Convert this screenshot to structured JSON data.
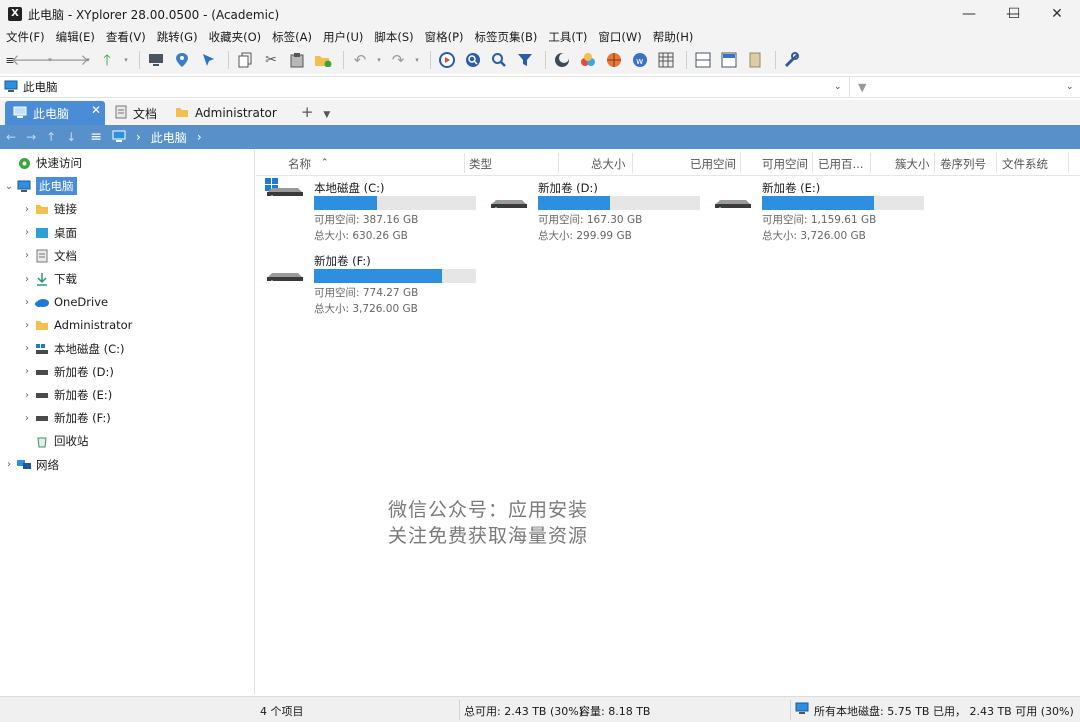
{
  "window": {
    "title": "此电脑 - XYplorer 28.00.0500 - (Academic)",
    "app_icon": "xyplorer-logo",
    "controls": {
      "minimize": "—",
      "maximize": "☐",
      "close": "✕"
    }
  },
  "menu": [
    "文件(F)",
    "编辑(E)",
    "查看(V)",
    "跳转(G)",
    "收藏夹(O)",
    "标签(A)",
    "用户(U)",
    "脚本(S)",
    "窗格(P)",
    "标签页集(B)",
    "工具(T)",
    "窗口(W)",
    "帮助(H)"
  ],
  "toolbar": {
    "icons": [
      "menu-icon",
      "back-icon",
      "forward-icon",
      "up-icon",
      "computer-icon",
      "location-pin-icon",
      "pointer-icon",
      "copy-icon",
      "cut-icon",
      "paste-icon",
      "new-folder-icon",
      "undo-icon",
      "redo-icon",
      "media-play-icon",
      "search-icon",
      "find-icon",
      "filter-icon",
      "moon-icon",
      "colors-icon",
      "basketball-icon",
      "badge-icon",
      "grid-icon",
      "split-h-icon",
      "split-v-icon",
      "book-icon",
      "tools-icon"
    ]
  },
  "address": {
    "value": "此电脑"
  },
  "tabs": [
    {
      "label": "此电脑",
      "active": true
    },
    {
      "label": "文档",
      "active": false
    },
    {
      "label": "Administrator",
      "active": false
    }
  ],
  "breadcrumb": {
    "label": "此电脑"
  },
  "tree": [
    {
      "label": "快速访问",
      "icon": "quick-access-icon",
      "indent": 1,
      "arrow": ""
    },
    {
      "label": "此电脑",
      "icon": "computer-icon",
      "indent": 1,
      "arrow": "⌄",
      "selected": true
    },
    {
      "label": "链接",
      "icon": "folder-icon",
      "indent": 2,
      "arrow": "›"
    },
    {
      "label": "桌面",
      "icon": "desktop-icon",
      "indent": 2,
      "arrow": "›"
    },
    {
      "label": "文档",
      "icon": "document-icon",
      "indent": 2,
      "arrow": "›"
    },
    {
      "label": "下载",
      "icon": "download-icon",
      "indent": 2,
      "arrow": "›"
    },
    {
      "label": "OneDrive",
      "icon": "cloud-icon",
      "indent": 2,
      "arrow": "›"
    },
    {
      "label": "Administrator",
      "icon": "folder-icon",
      "indent": 2,
      "arrow": "›"
    },
    {
      "label": "本地磁盘 (C:)",
      "icon": "system-drive-icon",
      "indent": 2,
      "arrow": "›"
    },
    {
      "label": "新加卷 (D:)",
      "icon": "drive-icon",
      "indent": 2,
      "arrow": "›"
    },
    {
      "label": "新加卷 (E:)",
      "icon": "drive-icon",
      "indent": 2,
      "arrow": "›"
    },
    {
      "label": "新加卷 (F:)",
      "icon": "drive-icon",
      "indent": 2,
      "arrow": "›"
    },
    {
      "label": "回收站",
      "icon": "recycle-bin-icon",
      "indent": 2,
      "arrow": ""
    },
    {
      "label": "网络",
      "icon": "network-icon",
      "indent": 0,
      "arrow": "›"
    }
  ],
  "columns": [
    "名称",
    "类型",
    "总大小",
    "已用空间",
    "可用空间",
    "已用百...",
    "簇大小",
    "卷序列号",
    "文件系统"
  ],
  "drives": [
    {
      "name": "本地磁盘 (C:)",
      "free": "可用空间: 387.16 GB",
      "total": "总大小: 630.26 GB",
      "used_fraction": 0.386,
      "system": true
    },
    {
      "name": "新加卷 (D:)",
      "free": "可用空间: 167.30 GB",
      "total": "总大小: 299.99 GB",
      "used_fraction": 0.442,
      "system": false
    },
    {
      "name": "新加卷 (E:)",
      "free": "可用空间: 1,159.61 GB",
      "total": "总大小: 3,726.00 GB",
      "used_fraction": 0.689,
      "system": false
    },
    {
      "name": "新加卷 (F:)",
      "free": "可用空间: 774.27 GB",
      "total": "总大小: 3,726.00 GB",
      "used_fraction": 0.792,
      "system": false
    }
  ],
  "watermark": {
    "line1": "微信公众号：应用安装",
    "line2": "关注免费获取海量资源"
  },
  "status": {
    "count": "4 个项目",
    "free_total": "总可用: 2.43 TB (30%)",
    "capacity": "容量: 8.18 TB",
    "all_drives": "所有本地磁盘: 5.75 TB 已用， 2.43 TB 可用 (30%)"
  }
}
